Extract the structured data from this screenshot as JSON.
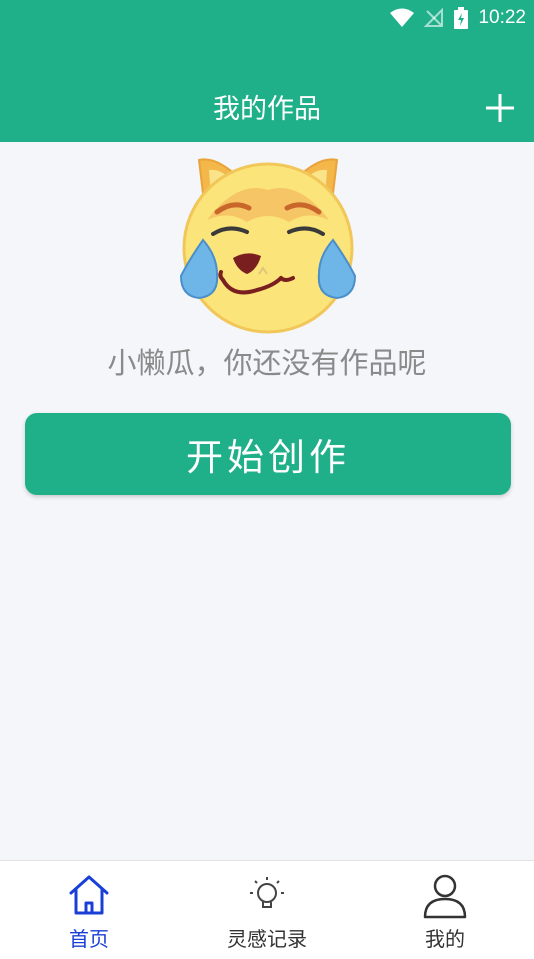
{
  "status_bar": {
    "time": "10:22"
  },
  "header": {
    "title": "我的作品",
    "add_icon": "plus-icon"
  },
  "empty_state": {
    "message": "小懒瓜，你还没有作品呢",
    "mascot": "crying-dog-emoji"
  },
  "start_button": {
    "label": "开始创作"
  },
  "tabbar": {
    "active_color": "#1a3fd6",
    "items": [
      {
        "label": "首页",
        "icon": "home-icon",
        "active": true
      },
      {
        "label": "灵感记录",
        "icon": "lightbulb-icon",
        "active": false
      },
      {
        "label": "我的",
        "icon": "user-icon",
        "active": false
      }
    ]
  },
  "colors": {
    "brand": "#1fb08a",
    "background": "#f5f6fa"
  }
}
